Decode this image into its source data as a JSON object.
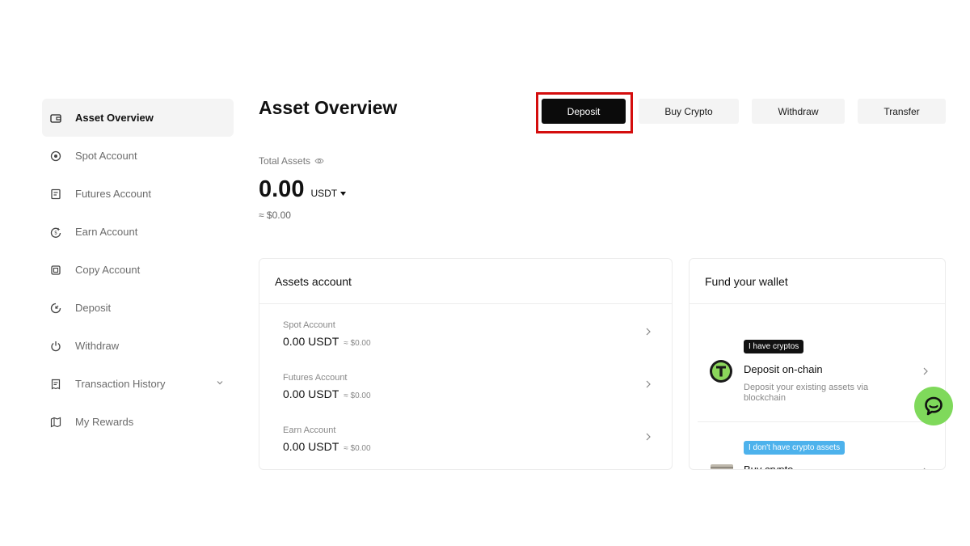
{
  "sidebar": {
    "items": [
      {
        "label": "Asset Overview",
        "icon": "wallet-icon"
      },
      {
        "label": "Spot Account",
        "icon": "target-icon"
      },
      {
        "label": "Futures Account",
        "icon": "document-icon"
      },
      {
        "label": "Earn Account",
        "icon": "earn-icon"
      },
      {
        "label": "Copy Account",
        "icon": "copy-icon"
      },
      {
        "label": "Deposit",
        "icon": "deposit-icon"
      },
      {
        "label": "Withdraw",
        "icon": "power-icon"
      },
      {
        "label": "Transaction History",
        "icon": "receipt-icon"
      },
      {
        "label": "My Rewards",
        "icon": "rewards-icon"
      }
    ]
  },
  "header": {
    "title": "Asset Overview",
    "buttons": {
      "deposit": "Deposit",
      "buy_crypto": "Buy Crypto",
      "withdraw": "Withdraw",
      "transfer": "Transfer"
    }
  },
  "total": {
    "label": "Total Assets",
    "value": "0.00",
    "unit": "USDT",
    "usd": "≈ $0.00"
  },
  "assets_card": {
    "title": "Assets account",
    "rows": [
      {
        "name": "Spot Account",
        "value": "0.00 USDT",
        "usd": "≈ $0.00"
      },
      {
        "name": "Futures Account",
        "value": "0.00 USDT",
        "usd": "≈ $0.00"
      },
      {
        "name": "Earn Account",
        "value": "0.00 USDT",
        "usd": "≈ $0.00"
      }
    ]
  },
  "fund_card": {
    "title": "Fund your wallet",
    "onchain": {
      "badge": "I have cryptos",
      "title": "Deposit on-chain",
      "description": "Deposit your existing assets via blockchain"
    },
    "buy": {
      "badge": "I don't have crypto assets",
      "title": "Buy crypto"
    }
  },
  "colors": {
    "highlight": "#d40d0d",
    "primary_button": "#0b0b0b",
    "badge_blue": "#4db2ec",
    "chat": "#7fd95b"
  }
}
